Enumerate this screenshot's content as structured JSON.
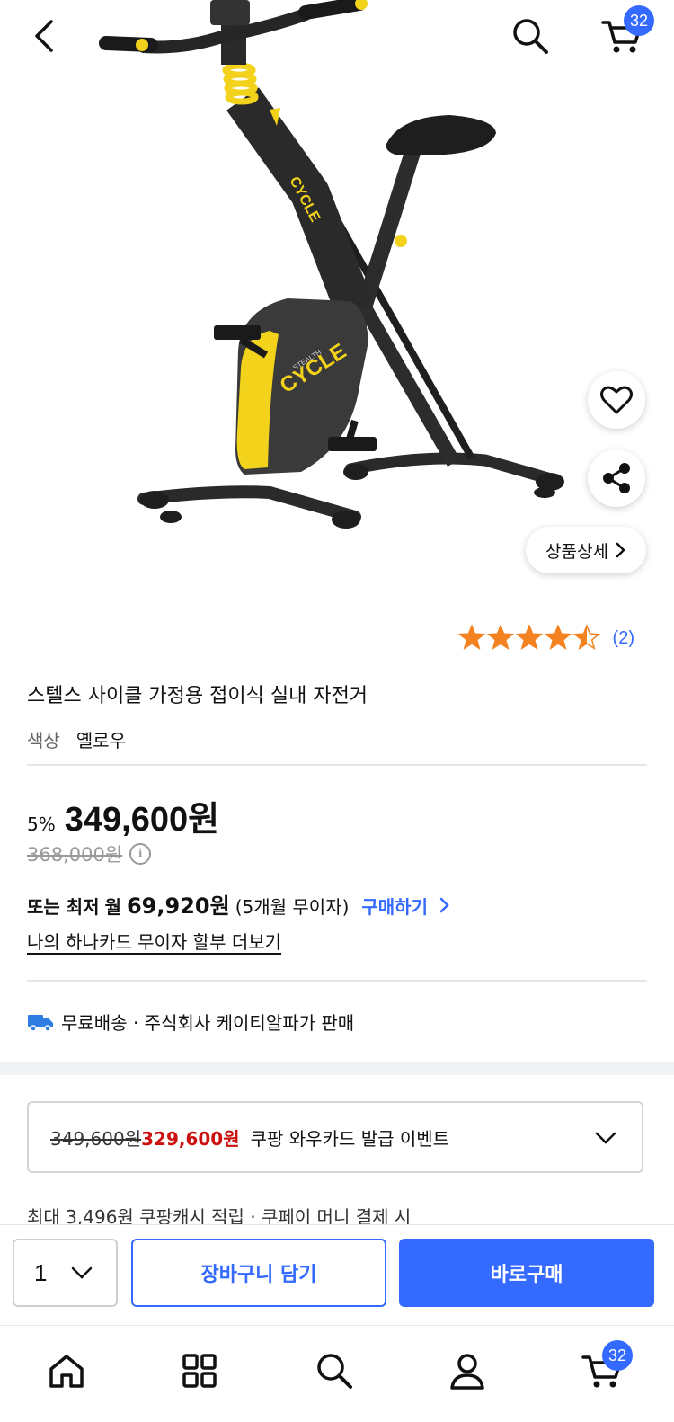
{
  "header": {
    "back_icon": "chevron-left-icon",
    "search_icon": "search-icon",
    "cart_icon": "cart-icon",
    "cart_count": "32"
  },
  "product_image": {
    "alt": "product-photo",
    "print_text": "CYCLE",
    "print_text_small": "STEALTH",
    "colors": {
      "frame": "#2a2a2a",
      "accent": "#f2d21b"
    }
  },
  "floating": {
    "favorite_icon": "heart-icon",
    "share_icon": "share-icon",
    "detail_label": "상품상세"
  },
  "rating": {
    "stars": 4.5,
    "max": 5,
    "count_label": "(2)",
    "star_color": "#f58220"
  },
  "product": {
    "title": "스텔스 사이클 가정용 접이식 실내 자전거",
    "option_label": "색상",
    "option_value": "옐로우"
  },
  "price": {
    "discount_rate": "5%",
    "sale_price": "349,600원",
    "original_price": "368,000원",
    "info_icon": "i"
  },
  "installment": {
    "prefix": "또는 최저",
    "month_label": "월",
    "amount": "69,920원",
    "terms": "(5개월 무이자)",
    "buy_link": "구매하기",
    "card_link": "나의 하나카드 무이자 할부 더보기"
  },
  "shipping": {
    "icon": "truck-icon",
    "text": "무료배송 · 주식회사 케이티알파가 판매"
  },
  "card_event": {
    "old_price": "349,600원",
    "new_price": "329,600원",
    "label": "쿠팡 와우카드 발급 이벤트"
  },
  "cash_back": {
    "text": "최대 3,496원 쿠팡캐시 적립 · 쿠페이 머니 결제 시"
  },
  "action_bar": {
    "quantity": "1",
    "add_to_cart": "장바구니 담기",
    "buy_now": "바로구매"
  },
  "tab_bar": {
    "items": [
      "home-icon",
      "category-icon",
      "search-icon",
      "my-page-icon",
      "cart-icon"
    ],
    "cart_count": "32"
  },
  "colors": {
    "accent": "#346aff",
    "sale": "#cc1111"
  }
}
